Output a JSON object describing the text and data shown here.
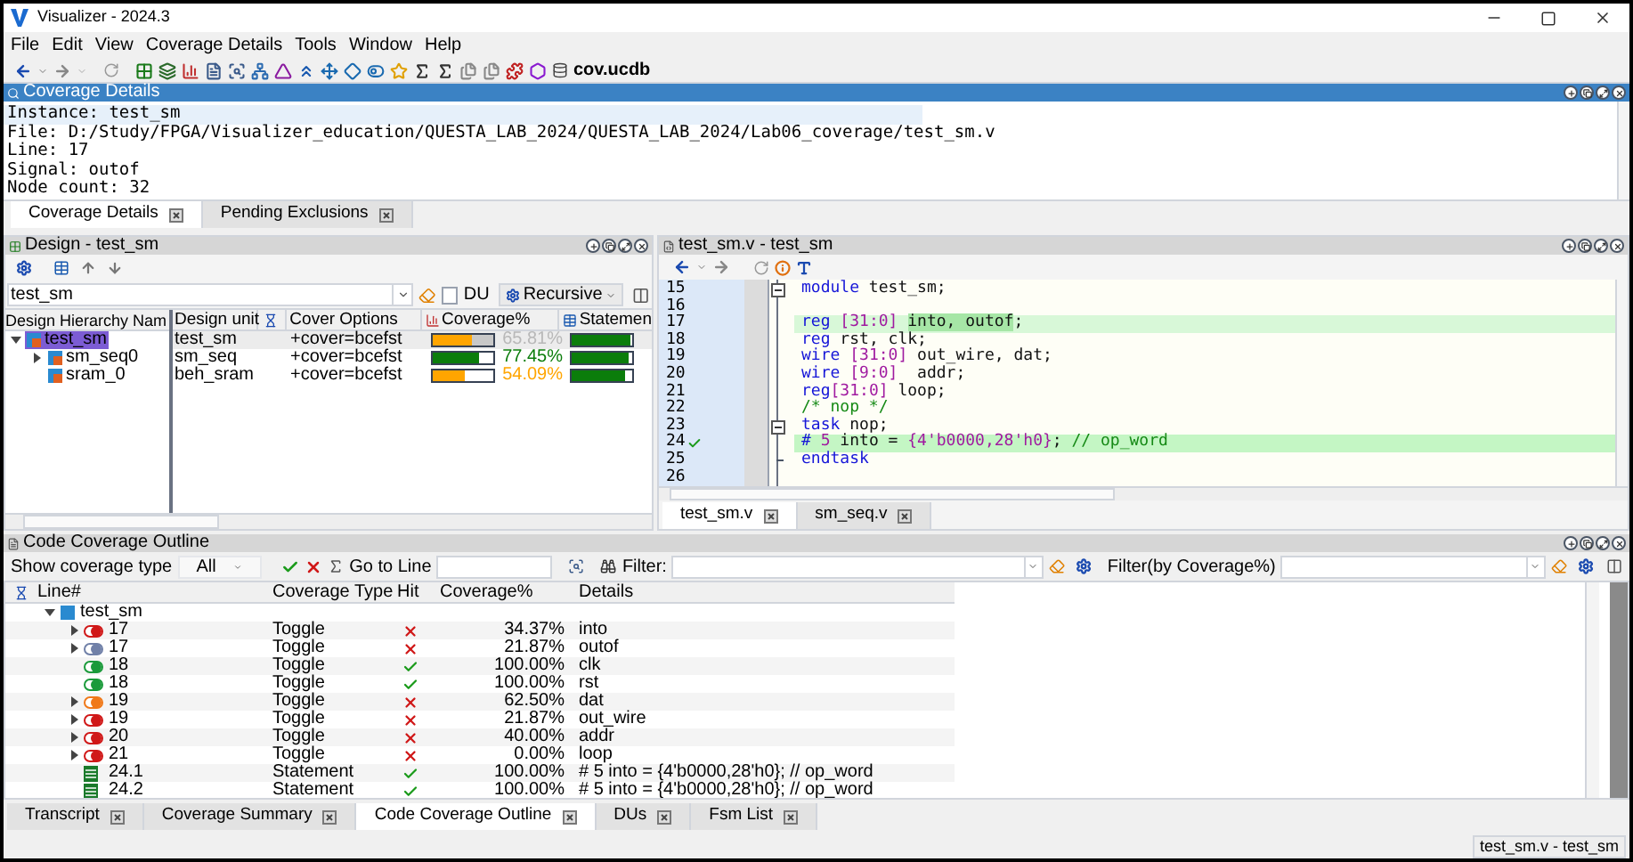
{
  "window": {
    "title": "Visualizer - 2024.3"
  },
  "menu": [
    "File",
    "Edit",
    "View",
    "Coverage Details",
    "Tools",
    "Window",
    "Help"
  ],
  "toolbar": {
    "database": "cov.ucdb"
  },
  "details_pane": {
    "title": "Coverage Details",
    "lines": [
      {
        "text": "Instance: test_sm",
        "selected": true
      },
      {
        "text": "File: D:/Study/FPGA/Visualizer_education/QUESTA_LAB_2024/QUESTA_LAB_2024/Lab06_coverage/test_sm.v",
        "selected": false
      },
      {
        "text": "Line: 17",
        "selected": false
      },
      {
        "text": "Signal: outof",
        "selected": false
      },
      {
        "text": "Node count: 32",
        "selected": false
      }
    ]
  },
  "upper_tabs": [
    {
      "label": "Coverage Details",
      "selected": true
    },
    {
      "label": "Pending Exclusions",
      "selected": false
    }
  ],
  "design_pane": {
    "title": "Design - test_sm",
    "filter": {
      "value": "test_sm"
    },
    "du": {
      "label": "DU",
      "checked": false
    },
    "scope": "Recursive",
    "columns": [
      "Design Hierarchy Nam",
      "Design unit",
      "Cover Options",
      "Coverage%",
      "Statemen"
    ],
    "rows": [
      {
        "name": "test_sm",
        "expandable": true,
        "expanded": true,
        "selected": true,
        "unit": "test_sm",
        "options": "+cover=bcefst",
        "coverage": {
          "text": "65.81%",
          "level": 0.66,
          "color": "#ffa500"
        },
        "statement": {
          "level": 0.97
        },
        "children": [
          {
            "name": "sm_seq0",
            "expandable": true,
            "expanded": false,
            "selected": false,
            "unit": "sm_seq",
            "options": "+cover=bcefst",
            "coverage": {
              "text": "77.45%",
              "level": 0.77,
              "color": "#0b7d0b"
            },
            "statement": {
              "level": 0.95
            }
          },
          {
            "name": "sram_0",
            "expandable": false,
            "selected": false,
            "unit": "beh_sram",
            "options": "+cover=bcefst",
            "coverage": {
              "text": "54.09%",
              "level": 0.54,
              "color": "#ffa500"
            },
            "statement": {
              "level": 0.88
            }
          }
        ]
      }
    ]
  },
  "source_pane": {
    "title": "test_sm.v - test_sm",
    "lines": [
      {
        "number": "15",
        "kind": "plain",
        "fold_start": true,
        "fold_end": false,
        "tokens": [
          {
            "text": "module",
            "kind": "kw"
          },
          {
            "text": " test_sm;",
            "kind": "plain"
          }
        ]
      },
      {
        "number": "16",
        "kind": "plain",
        "fold_start": false,
        "fold_end": false
      },
      {
        "number": "17",
        "kind": "current",
        "fold_start": false,
        "fold_end": false,
        "tokens": [
          {
            "text": "reg",
            "kind": "kw"
          },
          {
            "text": " [31:0] ",
            "kind": "num"
          },
          {
            "text": "into, outof",
            "kind": "match"
          },
          {
            "text": ";",
            "kind": "plain"
          }
        ]
      },
      {
        "number": "18",
        "kind": "plain",
        "fold_start": false,
        "fold_end": false,
        "tokens": [
          {
            "text": "reg",
            "kind": "kw"
          },
          {
            "text": " rst, clk;",
            "kind": "plain"
          }
        ]
      },
      {
        "number": "19",
        "kind": "plain",
        "fold_start": false,
        "fold_end": false,
        "tokens": [
          {
            "text": "wire",
            "kind": "kw"
          },
          {
            "text": " [31:0]",
            "kind": "num"
          },
          {
            "text": " out_wire, dat;",
            "kind": "plain"
          }
        ]
      },
      {
        "number": "20",
        "kind": "plain",
        "fold_start": false,
        "fold_end": false,
        "tokens": [
          {
            "text": "wire",
            "kind": "kw"
          },
          {
            "text": " [9:0]",
            "kind": "num"
          },
          {
            "text": "  addr;",
            "kind": "plain"
          }
        ]
      },
      {
        "number": "21",
        "kind": "plain",
        "fold_start": false,
        "fold_end": false,
        "tokens": [
          {
            "text": "reg",
            "kind": "kw"
          },
          {
            "text": "[31:0]",
            "kind": "num"
          },
          {
            "text": " loop;",
            "kind": "plain"
          }
        ]
      },
      {
        "number": "22",
        "kind": "plain",
        "fold_start": false,
        "fold_end": false,
        "tokens": [
          {
            "text": "/* nop */",
            "kind": "comment"
          }
        ]
      },
      {
        "number": "23",
        "kind": "plain",
        "fold_start": true,
        "fold_end": false,
        "tokens": [
          {
            "text": "task",
            "kind": "kw"
          },
          {
            "text": " nop;",
            "kind": "plain"
          }
        ]
      },
      {
        "number": "24",
        "kind": "covered",
        "fold_start": false,
        "fold_end": false,
        "tokens": [
          {
            "text": "#",
            "kind": "kw"
          },
          {
            "text": " 5",
            "kind": "num"
          },
          {
            "text": " into = ",
            "kind": "plain"
          },
          {
            "text": "{4'b0000,28'h0}",
            "kind": "num"
          },
          {
            "text": "; ",
            "kind": "plain"
          },
          {
            "text": "// op_word",
            "kind": "comment"
          }
        ]
      },
      {
        "number": "25",
        "kind": "plain",
        "fold_start": false,
        "fold_end": true,
        "tokens": [
          {
            "text": "endtask",
            "kind": "kw"
          }
        ]
      },
      {
        "number": "26",
        "kind": "plain",
        "fold_start": false,
        "fold_end": false
      }
    ],
    "tabs": [
      {
        "label": "test_sm.v",
        "selected": true
      },
      {
        "label": "sm_seq.v",
        "selected": false
      }
    ]
  },
  "outline_pane": {
    "title": "Code Coverage Outline",
    "type_label": "Show coverage type",
    "type_value": "All",
    "goto_label": "Go to Line",
    "filter_label": "Filter:",
    "coverage_filter_label": "Filter(by Coverage%)",
    "columns": [
      "Line#",
      "Coverage Type",
      "Hit",
      "Coverage%",
      "Details"
    ],
    "tree": {
      "name": "test_sm",
      "expanded": true,
      "children": [
        {
          "line": "17",
          "kind": "toggle",
          "color": "#d01818",
          "expandable": true,
          "expanded": false,
          "type": "Toggle",
          "hit": false,
          "coverage": "34.37%",
          "details": "into"
        },
        {
          "line": "17",
          "kind": "toggle",
          "color": "#7080a8",
          "expandable": true,
          "expanded": false,
          "type": "Toggle",
          "hit": false,
          "coverage": "21.87%",
          "details": "outof"
        },
        {
          "line": "18",
          "kind": "toggle",
          "color": "#1a9a3a",
          "expandable": false,
          "type": "Toggle",
          "hit": true,
          "coverage": "100.00%",
          "details": "clk"
        },
        {
          "line": "18",
          "kind": "toggle",
          "color": "#1a9a3a",
          "expandable": false,
          "type": "Toggle",
          "hit": true,
          "coverage": "100.00%",
          "details": "rst"
        },
        {
          "line": "19",
          "kind": "toggle",
          "color": "#f07818",
          "expandable": true,
          "expanded": false,
          "type": "Toggle",
          "hit": false,
          "coverage": "62.50%",
          "details": "dat"
        },
        {
          "line": "19",
          "kind": "toggle",
          "color": "#d01818",
          "expandable": true,
          "expanded": false,
          "type": "Toggle",
          "hit": false,
          "coverage": "21.87%",
          "details": "out_wire"
        },
        {
          "line": "20",
          "kind": "toggle",
          "color": "#d01818",
          "expandable": true,
          "expanded": false,
          "type": "Toggle",
          "hit": false,
          "coverage": "40.00%",
          "details": "addr"
        },
        {
          "line": "21",
          "kind": "toggle",
          "color": "#d01818",
          "expandable": true,
          "expanded": false,
          "type": "Toggle",
          "hit": false,
          "coverage": "0.00%",
          "details": "loop"
        },
        {
          "line": "24.1",
          "kind": "statement",
          "color": "#1a7a2a",
          "expandable": false,
          "type": "Statement",
          "hit": true,
          "coverage": "100.00%",
          "details": "# 5 into = {4'b0000,28'h0}; // op_word"
        },
        {
          "line": "24.2",
          "kind": "statement",
          "color": "#1a7a2a",
          "expandable": false,
          "type": "Statement",
          "hit": true,
          "coverage": "100.00%",
          "details": "# 5 into = {4'b0000,28'h0}; // op_word"
        }
      ]
    }
  },
  "bottom_tabs": [
    {
      "label": "Transcript",
      "selected": false
    },
    {
      "label": "Coverage Summary",
      "selected": false
    },
    {
      "label": "Code Coverage Outline",
      "selected": true
    },
    {
      "label": "DUs",
      "selected": false
    },
    {
      "label": "Fsm List",
      "selected": false
    }
  ],
  "status_bar": "test_sm.v - test_sm"
}
